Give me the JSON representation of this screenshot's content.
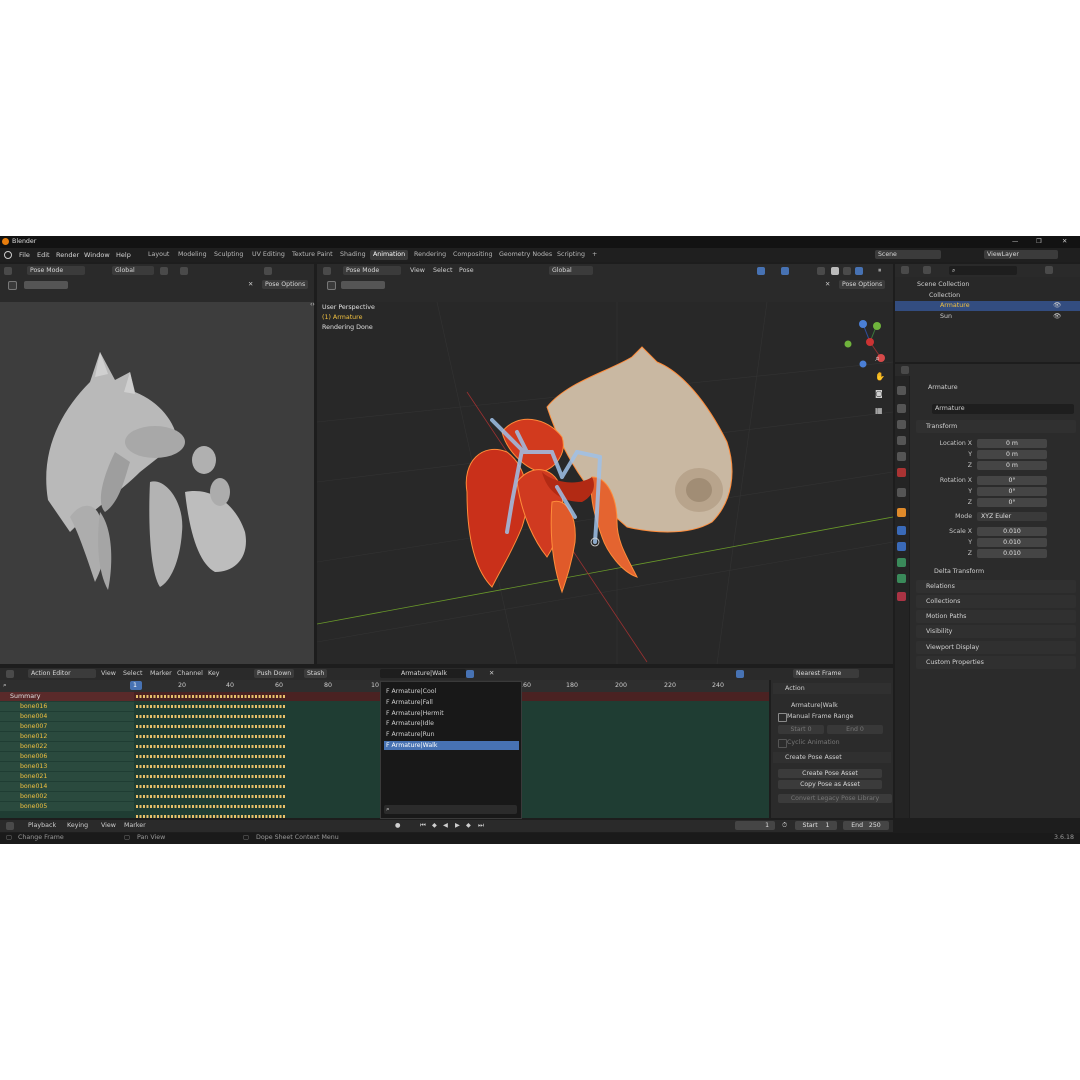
{
  "app": {
    "title": "Blender",
    "version": "3.6.18"
  },
  "menu": [
    "File",
    "Edit",
    "Render",
    "Window",
    "Help"
  ],
  "workspaces": [
    "Layout",
    "Modeling",
    "Sculpting",
    "UV Editing",
    "Texture Paint",
    "Shading",
    "Animation",
    "Rendering",
    "Compositing",
    "Geometry Nodes",
    "Scripting"
  ],
  "active_workspace": "Animation",
  "scene": "Scene",
  "view_layer": "ViewLayer",
  "left_viewport": {
    "mode": "Pose Mode",
    "orientation": "Global",
    "pose_options": "Pose Options"
  },
  "main_viewport": {
    "mode": "Pose Mode",
    "menus": [
      "View",
      "Select",
      "Pose"
    ],
    "orientation": "Global",
    "pose_options": "Pose Options",
    "overlay_lines": [
      "User Perspective",
      "(1) Armature",
      "Rendering Done"
    ]
  },
  "outliner": {
    "root": "Scene Collection",
    "collection": "Collection",
    "items": [
      "Armature",
      "Sun"
    ]
  },
  "properties": {
    "object": "Armature",
    "data": "Armature",
    "section": "Transform",
    "location": {
      "label": "Location X",
      "x": "0 m",
      "y": "0 m",
      "z": "0 m"
    },
    "rotation": {
      "label": "Rotation X",
      "x": "0°",
      "y": "0°",
      "z": "0°"
    },
    "mode_label": "Mode",
    "mode": "XYZ Euler",
    "scale": {
      "label": "Scale X",
      "x": "0.010",
      "y": "0.010",
      "z": "0.010"
    },
    "axis_y": "Y",
    "axis_z": "Z",
    "delta": "Delta Transform",
    "panels": [
      "Relations",
      "Collections",
      "Motion Paths",
      "Visibility",
      "Viewport Display",
      "Custom Properties"
    ]
  },
  "dope": {
    "editor": "Action Editor",
    "menus": [
      "View",
      "Select",
      "Marker",
      "Channel",
      "Key"
    ],
    "push_down": "Push Down",
    "stash": "Stash",
    "action": "Armature|Walk",
    "snap": "Nearest Frame",
    "ruler": [
      "20",
      "40",
      "60",
      "80",
      "10",
      "160",
      "180",
      "200",
      "220",
      "240"
    ],
    "current_frame": "1",
    "summary": "Summary",
    "bones": [
      "bone016",
      "bone004",
      "bone007",
      "bone012",
      "bone022",
      "bone006",
      "bone013",
      "bone021",
      "bone014",
      "bone002",
      "bone005"
    ],
    "actions": [
      "F Armature|Cool",
      "F Armature|Fall",
      "F Armature|Hermit",
      "F Armature|Idle",
      "F Armature|Run",
      "F Armature|Walk"
    ],
    "side": {
      "action_header": "Action",
      "action": "Armature|Walk",
      "manual_range": "Manual Frame Range",
      "start_label": "Start",
      "start": "0",
      "end_label": "End",
      "end": "0",
      "cyclic": "Cyclic Animation",
      "pose_header": "Create Pose Asset",
      "create": "Create Pose Asset",
      "copy": "Copy Pose as Asset",
      "convert": "Convert Legacy Pose Library"
    }
  },
  "timeline": {
    "menus": [
      "Playback",
      "Keying",
      "View",
      "Marker"
    ],
    "frame": "1",
    "start_label": "Start",
    "start": "1",
    "end_label": "End",
    "end": "250"
  },
  "status": [
    "Change Frame",
    "Pan View",
    "Dope Sheet Context Menu"
  ]
}
